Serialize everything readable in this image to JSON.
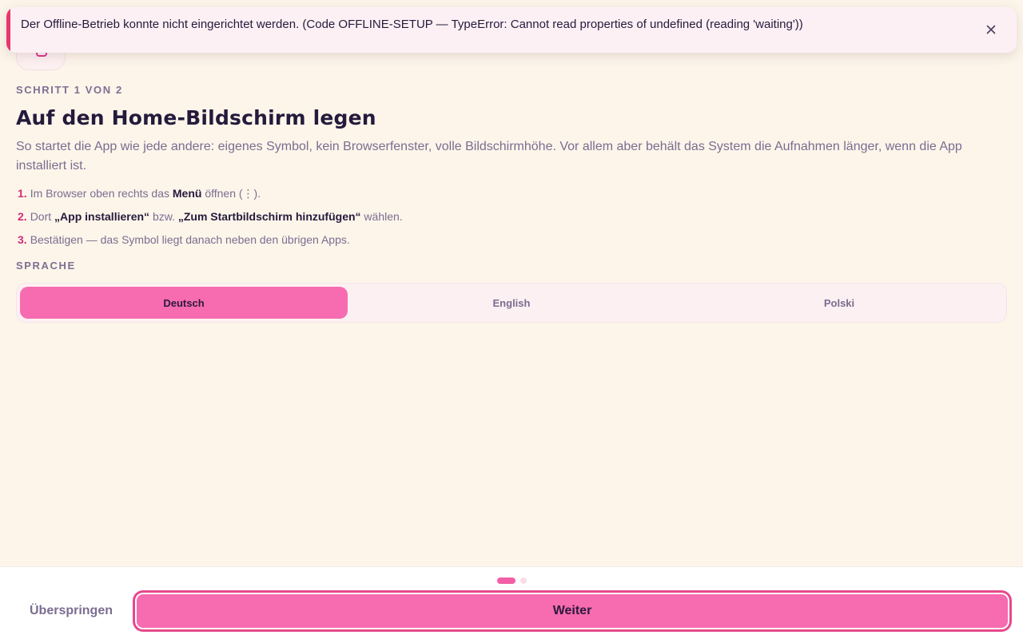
{
  "toast": {
    "message": "Der Offline-Betrieb konnte nicht eingerichtet werden. (Code OFFLINE-SETUP — TypeError: Cannot read properties of undefined (reading 'waiting'))",
    "close_icon": "close-icon",
    "accent_color": "#e8376a"
  },
  "app_icon": "app-icon",
  "onboarding": {
    "step_label": "SCHRITT 1 VON 2",
    "heading": "Auf den Home-Bildschirm legen",
    "intro": "So startet die App wie jede andere: eigenes Symbol, kein Browserfenster, volle Bildschirmhöhe. Vor allem aber behält das System die Aufnahmen länger, wenn die App installiert ist.",
    "steps": [
      {
        "num": "1.",
        "pre": "Im Browser oben rechts das ",
        "strong1": "Menü",
        "mid": " öffnen (⋮).",
        "strong2": "",
        "post": ""
      },
      {
        "num": "2.",
        "pre": "Dort ",
        "strong1": "„App installieren“",
        "mid": " bzw. ",
        "strong2": "„Zum Startbildschirm hinzufügen“",
        "post": " wählen."
      },
      {
        "num": "3.",
        "pre": "Bestätigen — das Symbol liegt danach neben den übrigen Apps.",
        "strong1": "",
        "mid": "",
        "strong2": "",
        "post": ""
      }
    ]
  },
  "language": {
    "label": "SPRACHE",
    "options": [
      "Deutsch",
      "English",
      "Polski"
    ],
    "selected": "Deutsch"
  },
  "footer": {
    "progress": {
      "current": 1,
      "total": 2
    },
    "skip_label": "Überspringen",
    "next_label": "Weiter"
  },
  "colors": {
    "background": "#fdf5ea",
    "accent": "#f76bb0",
    "step_number": "#d42a78"
  }
}
